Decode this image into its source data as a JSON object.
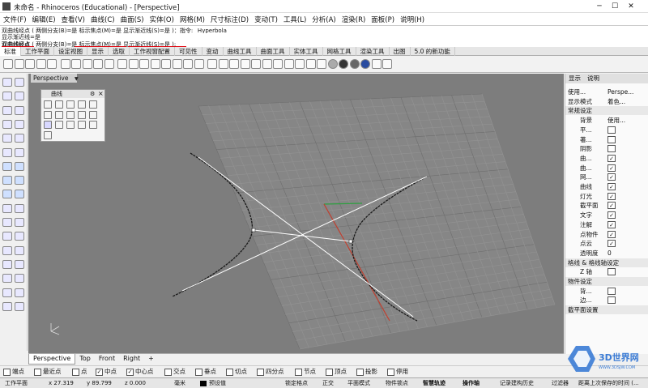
{
  "window": {
    "title": "未命名 - Rhinoceros (Educational) - [Perspective]"
  },
  "menu": [
    "文件(F)",
    "编辑(E)",
    "查看(V)",
    "曲线(C)",
    "曲面(S)",
    "实体(O)",
    "网格(M)",
    "尺寸标注(D)",
    "变动(T)",
    "工具(L)",
    "分析(A)",
    "渲染(R)",
    "面板(P)",
    "说明(H)"
  ],
  "command": {
    "history1": "双曲线经点 ( 两侧分支(B)=是  标示焦点(M)=是  显示渐近线(S)=是 )：指令: _Hyperbola",
    "history2": "显示渐近线=是",
    "prompt_label": "双曲线经点",
    "prompt_rest": " ( 两侧分支(B)=是  标示焦点(M)=是  显示渐近线(S)=是 ):"
  },
  "tabs": [
    "标准",
    "工作平面",
    "设定视图",
    "显示",
    "选取",
    "工作视窗配置",
    "可见性",
    "变动",
    "曲线工具",
    "曲面工具",
    "实体工具",
    "网格工具",
    "渲染工具",
    "出图",
    "5.0 的新功能"
  ],
  "viewport": {
    "title": "Perspective"
  },
  "curve_panel": {
    "title": "曲线"
  },
  "viewport_tabs": [
    "Perspective",
    "Top",
    "Front",
    "Right",
    "+"
  ],
  "right_panel": {
    "tabs": [
      "显示",
      "说明"
    ],
    "rows": [
      {
        "label": "使用...",
        "value": "Perspe..."
      },
      {
        "label": "显示模式",
        "value": "着色..."
      },
      {
        "label": "常规设定",
        "section": true
      },
      {
        "label": "背景",
        "value": "使用...",
        "indent": true
      },
      {
        "label": "平...",
        "check": false,
        "indent": true
      },
      {
        "label": "著...",
        "check": false,
        "indent": true
      },
      {
        "label": "阴影",
        "check": false,
        "indent": true
      },
      {
        "label": "曲...",
        "check": true,
        "indent": true
      },
      {
        "label": "曲...",
        "check": true,
        "indent": true
      },
      {
        "label": "网...",
        "check": true,
        "indent": true
      },
      {
        "label": "曲线",
        "check": true,
        "indent": true
      },
      {
        "label": "灯光",
        "check": true,
        "indent": true
      },
      {
        "label": "截平面",
        "check": true,
        "indent": true
      },
      {
        "label": "文字",
        "check": true,
        "indent": true
      },
      {
        "label": "注解",
        "check": true,
        "indent": true
      },
      {
        "label": "点物件",
        "check": true,
        "indent": true
      },
      {
        "label": "点云",
        "check": true,
        "indent": true
      },
      {
        "label": "透明度",
        "value": "0",
        "indent": true
      },
      {
        "label": "格线 & 格线轴设定",
        "section": true
      },
      {
        "label": "Z 轴",
        "check": false,
        "indent": true
      },
      {
        "label": "物件设定",
        "section": true
      },
      {
        "label": "背...",
        "check": false,
        "indent": true
      },
      {
        "label": "边...",
        "check": false,
        "indent": true
      },
      {
        "label": "截平面设置",
        "section": true
      }
    ]
  },
  "osnaps": [
    {
      "label": "端点",
      "check": false
    },
    {
      "label": "最近点",
      "check": false
    },
    {
      "label": "点",
      "check": false
    },
    {
      "label": "中点",
      "check": true
    },
    {
      "label": "中心点",
      "check": true
    },
    {
      "label": "交点",
      "check": false
    },
    {
      "label": "垂点",
      "check": false
    },
    {
      "label": "切点",
      "check": false
    },
    {
      "label": "四分点",
      "check": false
    },
    {
      "label": "节点",
      "check": false
    },
    {
      "label": "顶点",
      "check": false
    },
    {
      "label": "投影",
      "check": false
    },
    {
      "label": "停用",
      "check": false
    }
  ],
  "status": {
    "plane": "工作平面",
    "x": "x 27.319",
    "y": "y 89.799",
    "z": "z 0.000",
    "unit": "毫米",
    "layer": "预设值",
    "lock": "锁定格点",
    "ortho": "正交",
    "planar": "平面模式",
    "osnap": "物件锁点",
    "smarttrack": "智慧轨迹",
    "gumball": "操作轴",
    "history": "记录建构历史",
    "filter": "过滤器",
    "memo": "距离上次保存的时间 (..."
  },
  "watermark": {
    "text": "3D世界网",
    "sub": "WWW.3DSJW.COM"
  },
  "colors": {
    "viewport_bg": "#7d7d7d",
    "grid": "#8f8f8f",
    "axis_x": "#c04030",
    "axis_y": "#2ea040",
    "accent_red": "#e0000a"
  }
}
